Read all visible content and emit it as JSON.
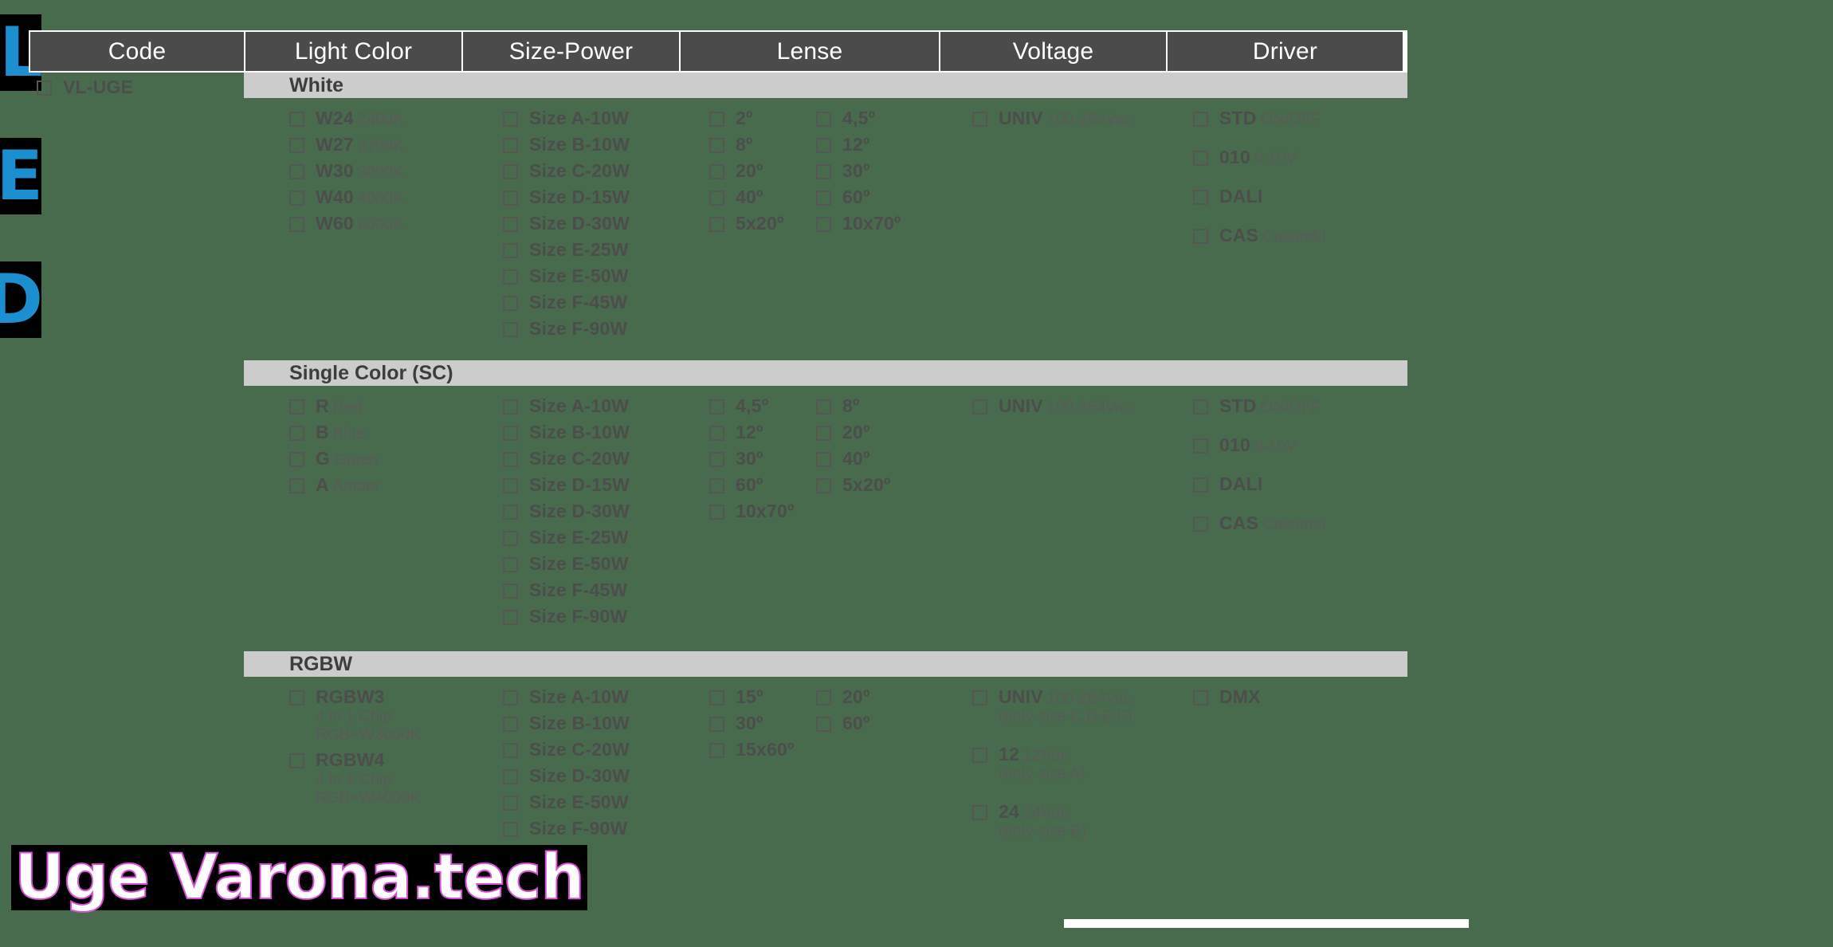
{
  "branding": {
    "edge_logo_glyphs": [
      "L",
      "E",
      "D"
    ],
    "edge_logo_color": "#1b8fcf",
    "watermark_text": "Uge Varona.tech",
    "watermark_color": "#ffffff",
    "watermark_outline_color": "#d84fd8"
  },
  "colors": {
    "page_background": "#486b4d",
    "header_background": "#4b4b4b",
    "header_text": "#ffffff",
    "band_background": "#cccccc",
    "body_text": "#4d4d4d",
    "muted_text": "#5a5a5a",
    "checkbox_border": "#565656"
  },
  "table": {
    "headers": [
      {
        "label": "Code"
      },
      {
        "label": "Light Color"
      },
      {
        "label": "Size-Power"
      },
      {
        "label": "Lense"
      },
      {
        "label": "Voltage"
      },
      {
        "label": "Driver"
      }
    ],
    "code": {
      "code": "VL-UGE",
      "desc": ""
    },
    "sections": [
      {
        "id": "white",
        "band": "White",
        "light_color": [
          {
            "code": "W24",
            "desc": "2400K"
          },
          {
            "code": "W27",
            "desc": "2700K"
          },
          {
            "code": "W30",
            "desc": "3000K"
          },
          {
            "code": "W40",
            "desc": "4000K"
          },
          {
            "code": "W60",
            "desc": "6000K"
          }
        ],
        "size_power": [
          {
            "code": "Size A-10W"
          },
          {
            "code": "Size B-10W"
          },
          {
            "code": "Size C-20W"
          },
          {
            "code": "Size D-15W"
          },
          {
            "code": "Size D-30W"
          },
          {
            "code": "Size E-25W"
          },
          {
            "code": "Size E-50W"
          },
          {
            "code": "Size F-45W"
          },
          {
            "code": "Size F-90W"
          }
        ],
        "lense_col1": [
          {
            "code": "2º"
          },
          {
            "code": "8º"
          },
          {
            "code": "20º"
          },
          {
            "code": "40º"
          },
          {
            "code": "5x20º"
          }
        ],
        "lense_col2": [
          {
            "code": "4,5º"
          },
          {
            "code": "12º"
          },
          {
            "code": "30º"
          },
          {
            "code": "60º"
          },
          {
            "code": "10x70º"
          }
        ],
        "voltage": [
          {
            "code": "UNIV",
            "desc": "100-264Vac",
            "notes": []
          }
        ],
        "driver": [
          {
            "code": "STD",
            "desc": "ON/OFF"
          },
          {
            "code": "010",
            "desc": "0-10V"
          },
          {
            "code": "DALI",
            "desc": ""
          },
          {
            "code": "CAS",
            "desc": "Casambi"
          }
        ]
      },
      {
        "id": "single-color",
        "band": "Single Color (SC)",
        "light_color": [
          {
            "code": "R",
            "desc": "Red"
          },
          {
            "code": "B",
            "desc": "Blue"
          },
          {
            "code": "G",
            "desc": "Green"
          },
          {
            "code": "A",
            "desc": "Amber"
          }
        ],
        "size_power": [
          {
            "code": "Size A-10W"
          },
          {
            "code": "Size B-10W"
          },
          {
            "code": "Size C-20W"
          },
          {
            "code": "Size D-15W"
          },
          {
            "code": "Size D-30W"
          },
          {
            "code": "Size E-25W"
          },
          {
            "code": "Size E-50W"
          },
          {
            "code": "Size F-45W"
          },
          {
            "code": "Size F-90W"
          }
        ],
        "lense_col1": [
          {
            "code": "4,5º"
          },
          {
            "code": "12º"
          },
          {
            "code": "30º"
          },
          {
            "code": "60º"
          },
          {
            "code": "10x70º"
          }
        ],
        "lense_col2": [
          {
            "code": "8º"
          },
          {
            "code": "20º"
          },
          {
            "code": "40º"
          },
          {
            "code": "5x20º"
          }
        ],
        "voltage": [
          {
            "code": "UNIV",
            "desc": "100-264Vac",
            "notes": []
          }
        ],
        "driver": [
          {
            "code": "STD",
            "desc": "ON/OFF"
          },
          {
            "code": "010",
            "desc": "0-10V"
          },
          {
            "code": "DALI",
            "desc": ""
          },
          {
            "code": "CAS",
            "desc": "Casambi"
          }
        ]
      },
      {
        "id": "rgbw",
        "band": "RGBW",
        "light_color": [
          {
            "code": "RGBW3",
            "desc": "",
            "notes": [
              "4 in 1 Chip",
              "RGB+W3000K"
            ]
          },
          {
            "code": "RGBW4",
            "desc": "",
            "notes": [
              "4 in 1 Chip",
              "RGB+W4000K"
            ]
          }
        ],
        "size_power": [
          {
            "code": "Size A-10W"
          },
          {
            "code": "Size B-10W"
          },
          {
            "code": "Size C-20W"
          },
          {
            "code": "Size D-30W"
          },
          {
            "code": "Size E-50W"
          },
          {
            "code": "Size F-90W"
          }
        ],
        "lense_col1": [
          {
            "code": "15º"
          },
          {
            "code": "30º"
          },
          {
            "code": "15x60º"
          }
        ],
        "lense_col2": [
          {
            "code": "20º"
          },
          {
            "code": "60º"
          }
        ],
        "voltage": [
          {
            "code": "UNIV",
            "desc": "100-264Vac",
            "notes": [
              "(only size C,D,E,F)"
            ]
          },
          {
            "code": "12",
            "desc": "12Vdc",
            "notes": [
              "(only size A)"
            ]
          },
          {
            "code": "24",
            "desc": "24Vdc",
            "notes": [
              "(only size B)"
            ]
          }
        ],
        "driver": [
          {
            "code": "DMX",
            "desc": ""
          }
        ]
      }
    ]
  }
}
